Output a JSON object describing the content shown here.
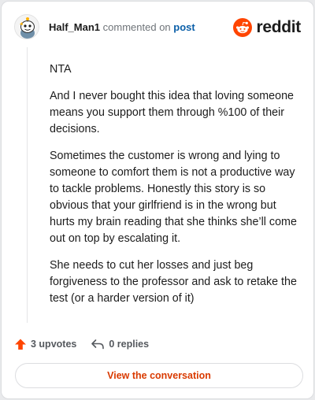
{
  "comment": {
    "username": "Half_Man1",
    "commented_on_text": "commented on",
    "post_link_text": "post",
    "paragraphs": [
      "NTA",
      "And I never bought this idea that loving someone means you support them through %100 of their decisions.",
      "Sometimes the customer is wrong and lying to someone to comfort them is not a productive way to tackle problems. Honestly this story is so obvious that your girlfriend is in the wrong but hurts my brain reading that she thinks she’ll come out on top by escalating it.",
      "She needs to cut her losses and just beg forgiveness to the professor and ask to retake the test (or a harder version of it)"
    ]
  },
  "brand": {
    "wordmark": "reddit",
    "color": "#ff4500"
  },
  "actions": {
    "upvotes_label": "3 upvotes",
    "replies_label": "0 replies",
    "upvote_color": "#ff4500"
  },
  "footer": {
    "view_conversation_label": "View the conversation"
  },
  "icons": [
    "avatar",
    "reddit-logo-icon",
    "upvote-arrow-icon",
    "reply-arrow-icon"
  ]
}
